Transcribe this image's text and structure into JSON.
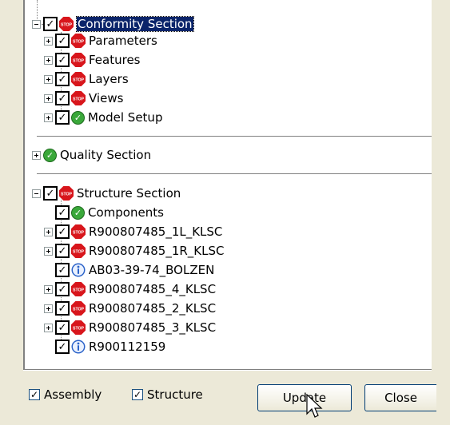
{
  "tree": {
    "conformity": {
      "label": "Conformity Section",
      "children": [
        "Parameters",
        "Features",
        "Layers",
        "Views",
        "Model Setup"
      ]
    },
    "quality": {
      "label": "Quality Section"
    },
    "structure": {
      "label": "Structure Section",
      "children": [
        "Components",
        "R900807485_1L_KLSC",
        "R900807485_1R_KLSC",
        "AB03-39-74_BOLZEN",
        "R900807485_4_KLSC",
        "R900807485_2_KLSC",
        "R900807485_3_KLSC",
        "R900112159"
      ]
    }
  },
  "options": {
    "assembly_label": "Assembly",
    "structure_label": "Structure"
  },
  "buttons": {
    "update_label": "Update",
    "close_label": "Close"
  },
  "colors": {
    "stop": "#d8161c",
    "ok": "#3aa83a",
    "info": "#2a62c9",
    "selection": "#0a246a"
  }
}
